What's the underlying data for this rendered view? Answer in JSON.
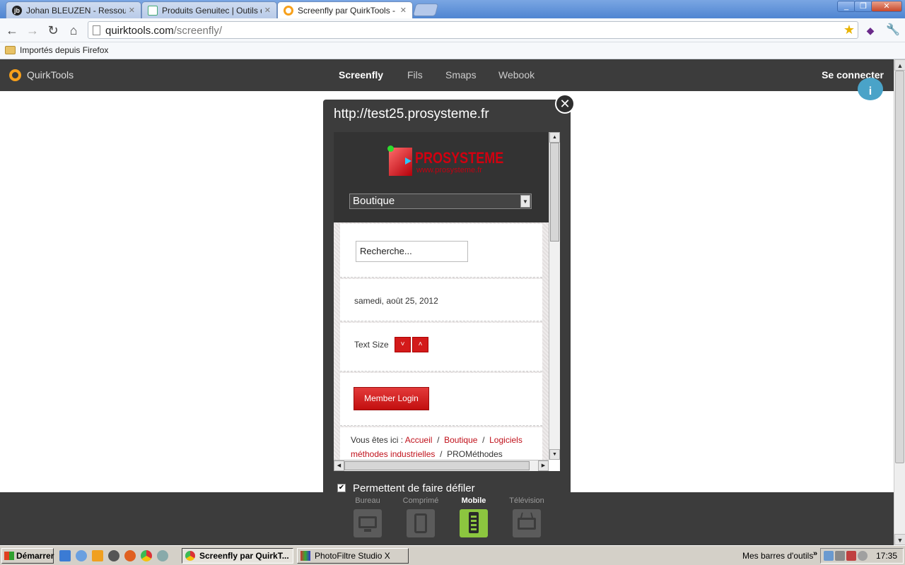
{
  "browser": {
    "tabs": [
      {
        "label": "Johan BLEUZEN - Ressource",
        "icon": "jb-avatar-icon",
        "active": false
      },
      {
        "label": "Produits Genuitec | Outils de d",
        "icon": "genuitec-icon",
        "active": false
      },
      {
        "label": "Screenfly par QuirkTools - Tes",
        "icon": "quirktools-icon",
        "active": true
      }
    ],
    "url_host": "quirktools.com",
    "url_path": "/screenfly/",
    "bookmark_folder": "Importés depuis Firefox",
    "window_controls": [
      "_",
      "❐",
      "✕"
    ]
  },
  "site": {
    "brand": "QuirkTools",
    "brand_color": "#f7a01b",
    "nav": [
      "Screenfly",
      "Fils",
      "Smaps",
      "Webook"
    ],
    "active_nav": "Screenfly",
    "login": "Se connecter",
    "help_icon": "info-icon"
  },
  "modal": {
    "url": "http://test25.prosysteme.fr",
    "close_glyph": "✕",
    "scroll_option_label": "Permettent de faire défiler",
    "scroll_option_checked": true
  },
  "preview": {
    "logo_text": "PROSYSTEME",
    "logo_sub": "www.prosysteme.fr",
    "select_value": "Boutique",
    "search_value": "Recherche...",
    "date": "samedi, août 25, 2012",
    "text_size_label": "Text Size",
    "text_size_down": "˅",
    "text_size_up": "˄",
    "login_button": "Member Login",
    "breadcrumb_prefix": "Vous êtes ici :",
    "breadcrumb_links": [
      "Accueil",
      "Boutique",
      "Logiciels méthodes industrielles"
    ],
    "breadcrumb_current": "PROMéthodes",
    "accent": "#d31a1a"
  },
  "devices": [
    {
      "label": "Bureau",
      "icon": "monitor-icon",
      "active": false
    },
    {
      "label": "Comprimé",
      "icon": "tablet-icon",
      "active": false
    },
    {
      "label": "Mobile",
      "icon": "mobile-phone-icon",
      "active": true
    },
    {
      "label": "Télévision",
      "icon": "tv-icon",
      "active": false
    }
  ],
  "taskbar": {
    "start": "Démarrer",
    "tasks": [
      {
        "label": "Screenfly par QuirkT...",
        "pressed": true
      },
      {
        "label": "PhotoFiltre Studio X",
        "pressed": false
      }
    ],
    "toolbars_label": "Mes barres d'outils",
    "clock": "17:35"
  }
}
